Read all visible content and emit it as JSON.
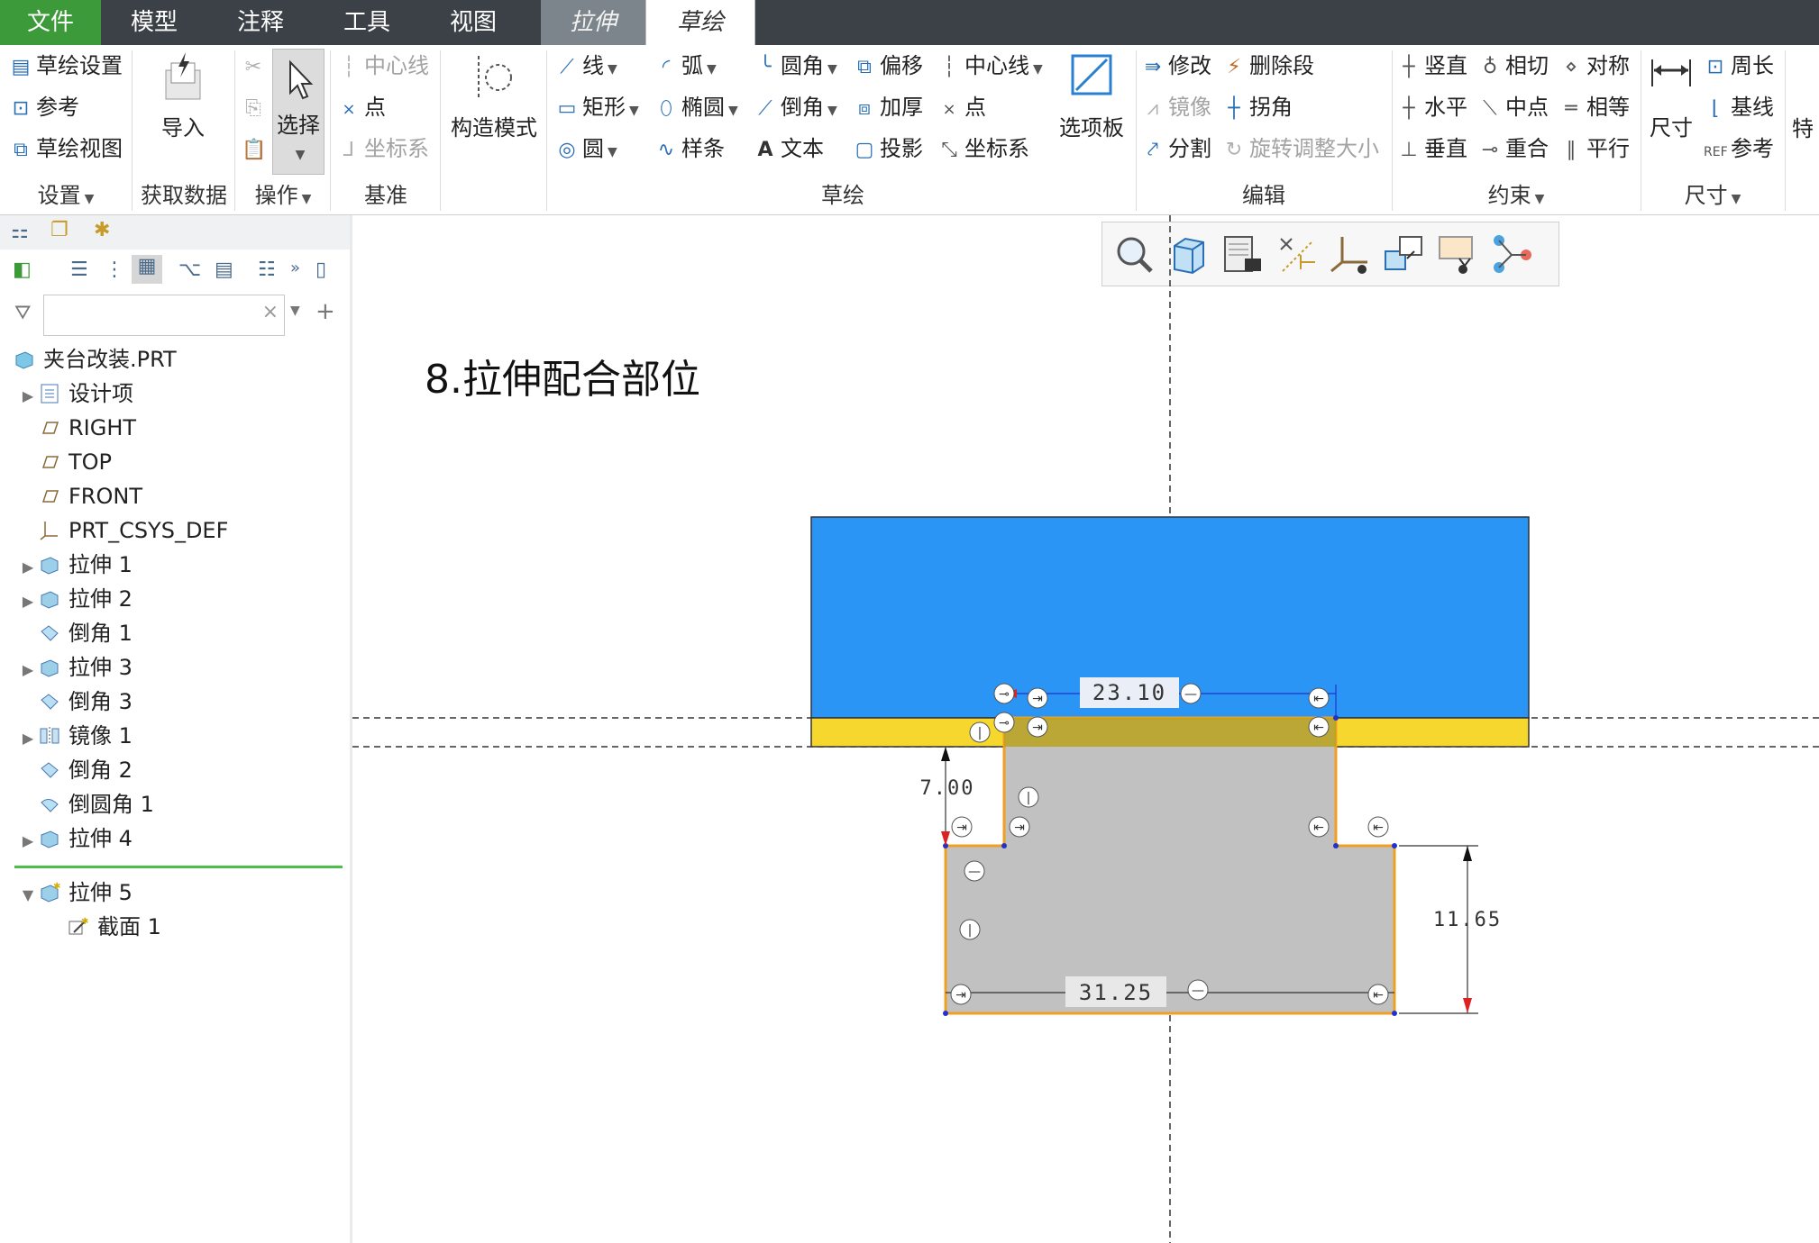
{
  "menu": {
    "tabs": [
      {
        "label": "文件"
      },
      {
        "label": "模型"
      },
      {
        "label": "注释"
      },
      {
        "label": "工具"
      },
      {
        "label": "视图"
      },
      {
        "label": "拉伸"
      },
      {
        "label": "草绘"
      }
    ]
  },
  "ribbon": {
    "setup": {
      "items": [
        "草绘设置",
        "参考",
        "草绘视图"
      ],
      "label": "设置"
    },
    "getdata": {
      "import": "导入",
      "label": "获取数据"
    },
    "operations": {
      "select": "选择",
      "label": "操作"
    },
    "datum": {
      "items": [
        "中心线",
        "点",
        "坐标系"
      ],
      "label": "基准"
    },
    "construction": "构造模式",
    "sketch": {
      "col1": [
        "线",
        "矩形",
        "圆"
      ],
      "col2": [
        "弧",
        "椭圆",
        "样条"
      ],
      "col3": [
        "圆角",
        "倒角",
        "文本"
      ],
      "col4": [
        "偏移",
        "加厚",
        "投影"
      ],
      "col5": [
        "中心线",
        "点",
        "坐标系"
      ],
      "palette": "选项板",
      "label": "草绘"
    },
    "edit": {
      "items": [
        "修改",
        "删除段",
        "镜像",
        "拐角",
        "分割",
        "旋转调整大小"
      ],
      "label": "编辑"
    },
    "constrain": {
      "col1": [
        "竖直",
        "水平",
        "垂直"
      ],
      "col2": [
        "相切",
        "中点",
        "重合"
      ],
      "col3": [
        "对称",
        "相等",
        "平行"
      ],
      "label": "约束"
    },
    "dimension": {
      "dim": "尺寸",
      "items": [
        "周长",
        "基线",
        "参考"
      ],
      "label": "尺寸"
    },
    "inspect": {
      "label": "特"
    }
  },
  "tree": {
    "search_placeholder": "",
    "items": [
      {
        "label": "夹台改装.PRT"
      },
      {
        "label": "设计项"
      },
      {
        "label": "RIGHT"
      },
      {
        "label": "TOP"
      },
      {
        "label": "FRONT"
      },
      {
        "label": "PRT_CSYS_DEF"
      },
      {
        "label": "拉伸 1"
      },
      {
        "label": "拉伸 2"
      },
      {
        "label": "倒角 1"
      },
      {
        "label": "拉伸 3"
      },
      {
        "label": "倒角 3"
      },
      {
        "label": "镜像 1"
      },
      {
        "label": "倒角 2"
      },
      {
        "label": "倒圆角 1"
      },
      {
        "label": "拉伸 4"
      },
      {
        "label": "拉伸 5"
      },
      {
        "label": "截面 1"
      }
    ]
  },
  "canvas": {
    "annotation": "8.拉伸配合部位",
    "dims": {
      "top_width": "23.10",
      "left_height": "7.00",
      "right_height": "11.65",
      "bottom_width": "31.25"
    }
  },
  "colors": {
    "menubar": "#3b4147",
    "file_tab": "#3c9a3a",
    "accent_icon": "#2a6fb5",
    "blue_body": "#2b95f5",
    "yellow_band": "#f6d72e",
    "gray_section": "#c1c1c1",
    "sketch_edge": "#f0a020"
  }
}
